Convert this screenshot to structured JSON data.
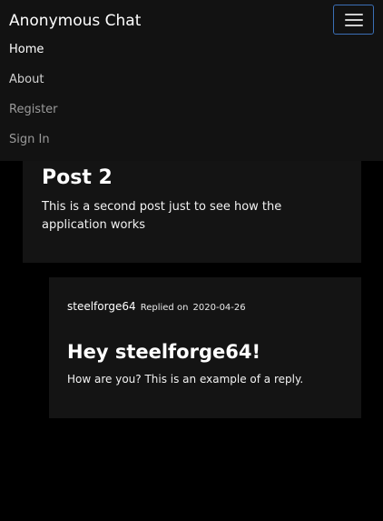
{
  "navbar": {
    "brand": "Anonymous Chat",
    "toggle_icon": "hamburger-menu-icon",
    "links": [
      {
        "label": "Home"
      },
      {
        "label": "About"
      },
      {
        "label": "Register"
      },
      {
        "label": "Sign In"
      }
    ]
  },
  "post": {
    "title": "Post 2",
    "body": "This is a second post just to see how the application works"
  },
  "reply": {
    "author": "steelforge64",
    "replied_label": "Replied on",
    "date": "2020-04-26",
    "title": "Hey steelforge64!",
    "body": "How are you? This is an example of a reply."
  },
  "colors": {
    "page_background": "#000000",
    "navbar_background": "#121212",
    "card_background": "#141414",
    "toggler_border": "#3b6fb6",
    "text_primary": "#ffffff",
    "text_muted": "#9a9a9a"
  }
}
